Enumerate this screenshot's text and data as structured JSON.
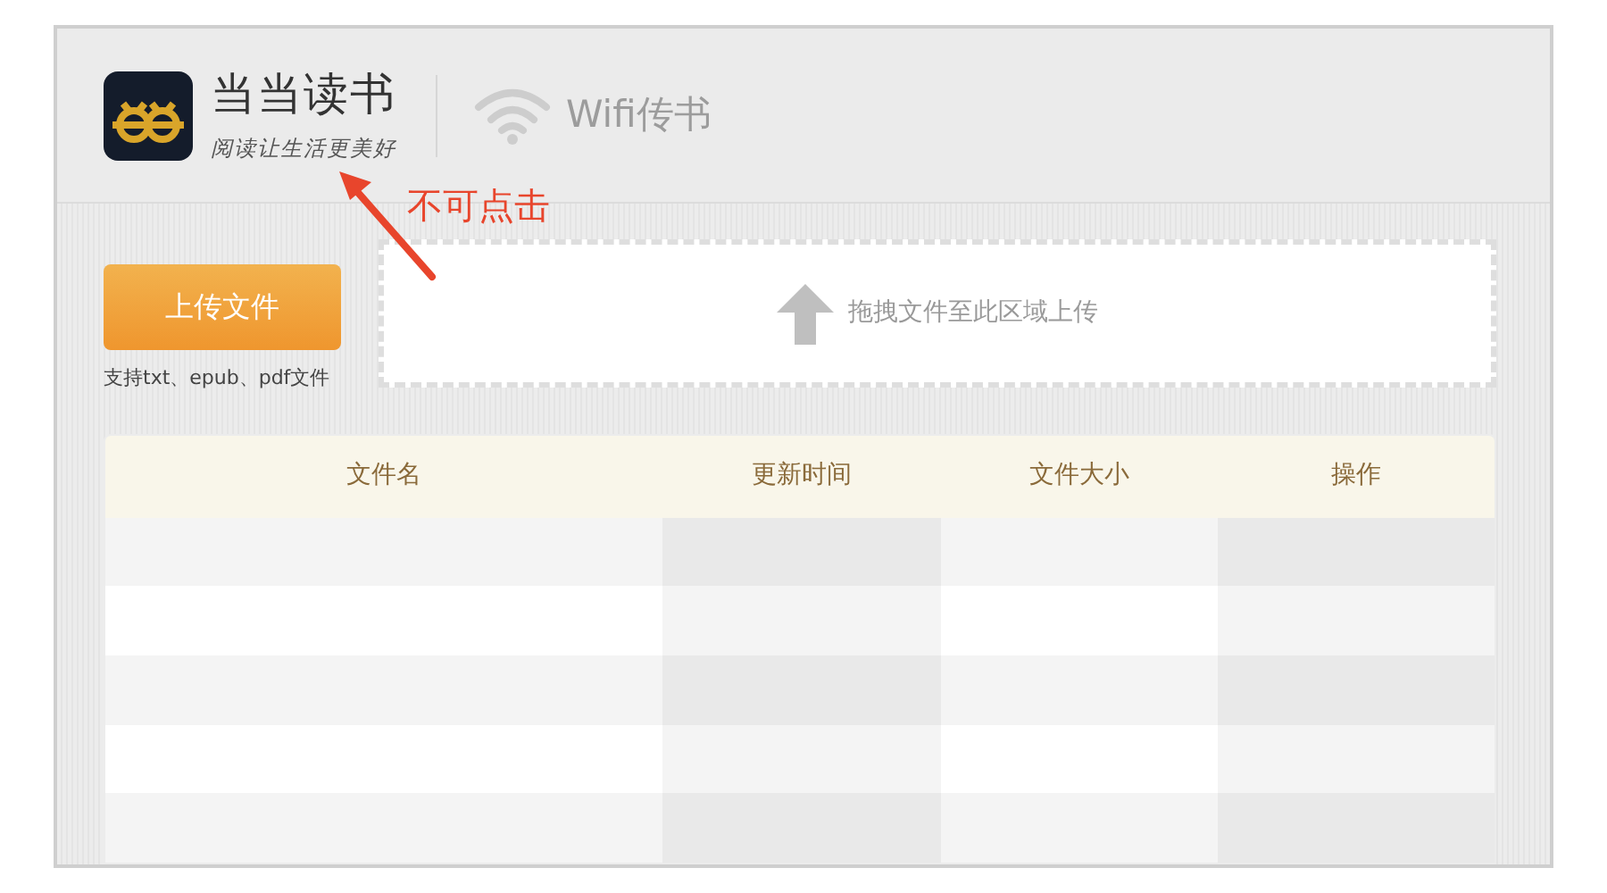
{
  "header": {
    "app_name": "当当读书",
    "slogan": "阅读让生活更美好",
    "wifi_label": "Wifi传书"
  },
  "annotation": {
    "text": "不可点击"
  },
  "upload": {
    "button": "上传文件",
    "hint": "支持txt、epub、pdf文件",
    "drop_text": "拖拽文件至此区域上传"
  },
  "table": {
    "columns": [
      "文件名",
      "更新时间",
      "文件大小",
      "操作"
    ]
  }
}
